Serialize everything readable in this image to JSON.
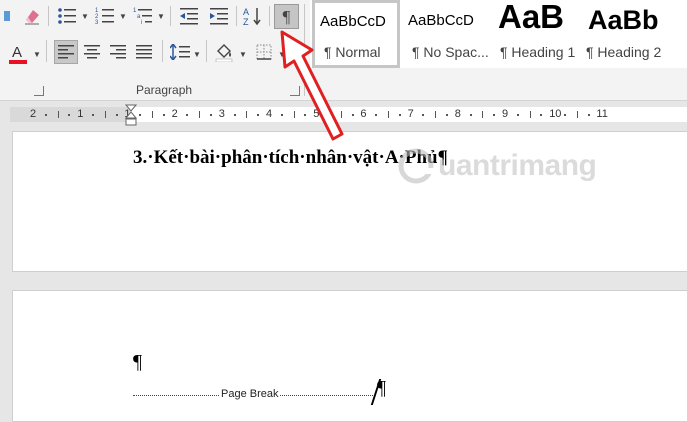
{
  "ribbon": {
    "paragraph_group_label": "Paragraph",
    "show_hide_symbol": "¶",
    "sort_label": "A↓Z",
    "font_color": "#e81123",
    "styles": [
      {
        "sample": "AaBbCcD",
        "name": "¶ Normal",
        "active": true
      },
      {
        "sample": "AaBbCcD",
        "name": "¶ No Spac..."
      },
      {
        "sample": "AaB",
        "name": "¶ Heading 1"
      },
      {
        "sample": "AaBb",
        "name": "¶ Heading 2"
      }
    ]
  },
  "ruler": {
    "labels": [
      "2",
      "1",
      "1",
      "2",
      "3",
      "4",
      "5",
      "6",
      "7",
      "8",
      "9",
      "10",
      "11"
    ]
  },
  "document": {
    "heading": "3.·Kết·bài·phân·tích·nhân·vật·A·Phủ¶",
    "empty_paragraph": "¶",
    "page_break_label": "Page Break",
    "break_pilcrow": "¶"
  },
  "watermark": {
    "text": "uantrimang"
  },
  "annotation": {
    "arrow_color": "#e02020"
  }
}
